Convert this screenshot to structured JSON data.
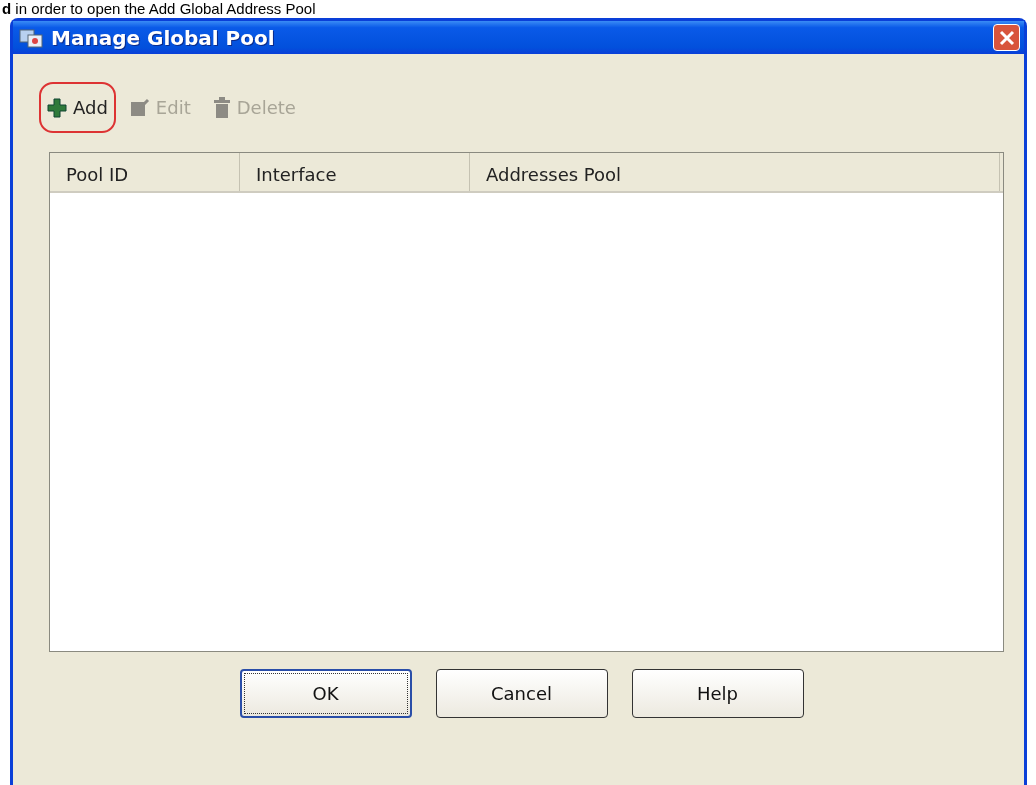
{
  "caption": "**d** in order to open the Add Global Address Pool",
  "window": {
    "title": "Manage Global Pool"
  },
  "toolbar": [
    {
      "label": "Add",
      "kind": "add",
      "disabled": false,
      "highlighted": true
    },
    {
      "label": "Edit",
      "kind": "edit",
      "disabled": true,
      "highlighted": false
    },
    {
      "label": "Delete",
      "kind": "delete",
      "disabled": true,
      "highlighted": false
    }
  ],
  "table": {
    "columns": [
      "Pool ID",
      "Interface",
      "Addresses Pool"
    ]
  },
  "buttons": [
    {
      "label": "OK",
      "default": true
    },
    {
      "label": "Cancel",
      "default": false
    },
    {
      "label": "Help",
      "default": false
    }
  ]
}
